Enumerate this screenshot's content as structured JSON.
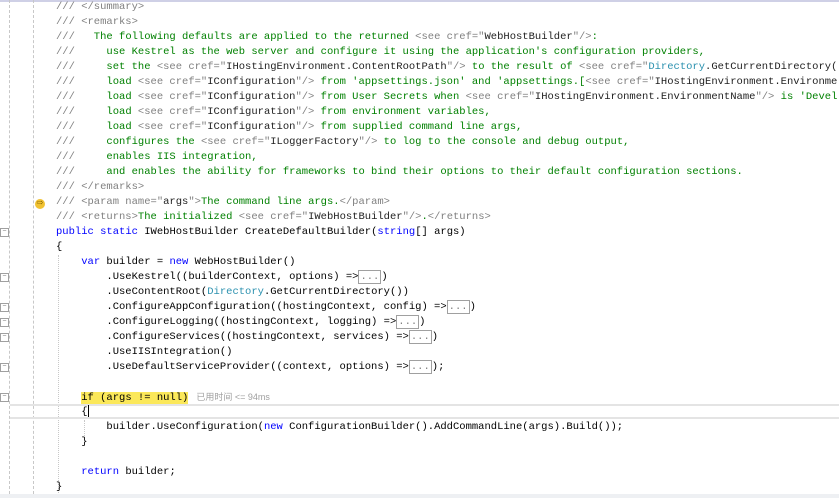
{
  "editor": {
    "perf_hint": "已用时间 <= 94ms",
    "lines": [
      [
        [
          "c",
          "/// </summary>"
        ]
      ],
      [
        [
          "c",
          "/// <remarks>"
        ]
      ],
      [
        [
          "c",
          "///"
        ],
        [
          "g",
          "   The following defaults are applied to the returned "
        ],
        [
          "c",
          "<see cref=\""
        ],
        [
          "d",
          "WebHostBuilder"
        ],
        [
          "c",
          "\"/>"
        ],
        [
          "g",
          ":"
        ]
      ],
      [
        [
          "c",
          "///"
        ],
        [
          "g",
          "     use Kestrel as the web server and configure it using the application's configuration providers,"
        ]
      ],
      [
        [
          "c",
          "///"
        ],
        [
          "g",
          "     set the "
        ],
        [
          "c",
          "<see cref=\""
        ],
        [
          "d",
          "IHostingEnvironment.ContentRootPath"
        ],
        [
          "c",
          "\"/>"
        ],
        [
          "g",
          " to the result of "
        ],
        [
          "c",
          "<see cref=\""
        ],
        [
          "t",
          "Directory"
        ],
        [
          "d",
          ".GetCurrentDirectory()"
        ]
      ],
      [
        [
          "c",
          "///"
        ],
        [
          "g",
          "     load "
        ],
        [
          "c",
          "<see cref=\""
        ],
        [
          "d",
          "IConfiguration"
        ],
        [
          "c",
          "\"/>"
        ],
        [
          "g",
          " from 'appsettings.json' and 'appsettings.["
        ],
        [
          "c",
          "<see cref=\""
        ],
        [
          "d",
          "IHostingEnvironment.Environme"
        ]
      ],
      [
        [
          "c",
          "///"
        ],
        [
          "g",
          "     load "
        ],
        [
          "c",
          "<see cref=\""
        ],
        [
          "d",
          "IConfiguration"
        ],
        [
          "c",
          "\"/>"
        ],
        [
          "g",
          " from User Secrets when "
        ],
        [
          "c",
          "<see cref=\""
        ],
        [
          "d",
          "IHostingEnvironment.EnvironmentName"
        ],
        [
          "c",
          "\"/>"
        ],
        [
          "g",
          " is 'Devel"
        ]
      ],
      [
        [
          "c",
          "///"
        ],
        [
          "g",
          "     load "
        ],
        [
          "c",
          "<see cref=\""
        ],
        [
          "d",
          "IConfiguration"
        ],
        [
          "c",
          "\"/>"
        ],
        [
          "g",
          " from environment variables,"
        ]
      ],
      [
        [
          "c",
          "///"
        ],
        [
          "g",
          "     load "
        ],
        [
          "c",
          "<see cref=\""
        ],
        [
          "d",
          "IConfiguration"
        ],
        [
          "c",
          "\"/>"
        ],
        [
          "g",
          " from supplied command line args,"
        ]
      ],
      [
        [
          "c",
          "///"
        ],
        [
          "g",
          "     configures the "
        ],
        [
          "c",
          "<see cref=\""
        ],
        [
          "d",
          "ILoggerFactory"
        ],
        [
          "c",
          "\"/>"
        ],
        [
          "g",
          " to log to the console and debug output,"
        ]
      ],
      [
        [
          "c",
          "///"
        ],
        [
          "g",
          "     enables IIS integration,"
        ]
      ],
      [
        [
          "c",
          "///"
        ],
        [
          "g",
          "     and enables the ability for frameworks to bind their options to their default configuration sections."
        ]
      ],
      [
        [
          "c",
          "/// </remarks>"
        ]
      ],
      [
        [
          "c",
          "/// <param name=\""
        ],
        [
          "d",
          "args"
        ],
        [
          "c",
          "\">"
        ],
        [
          "g",
          "The command line args."
        ],
        [
          "c",
          "</param>"
        ]
      ],
      [
        [
          "c",
          "/// <returns>"
        ],
        [
          "g",
          "The initialized "
        ],
        [
          "c",
          "<see cref=\""
        ],
        [
          "d",
          "IWebHostBuilder"
        ],
        [
          "c",
          "\"/>"
        ],
        [
          "g",
          "."
        ],
        [
          "c",
          "</returns>"
        ]
      ],
      [
        [
          "k",
          "public"
        ],
        [
          "p",
          " "
        ],
        [
          "k",
          "static"
        ],
        [
          "p",
          " IWebHostBuilder CreateDefaultBuilder("
        ],
        [
          "k",
          "string"
        ],
        [
          "p",
          "[] args)"
        ]
      ],
      [
        [
          "p",
          "{"
        ]
      ],
      [
        [
          "p",
          "    "
        ],
        [
          "k",
          "var"
        ],
        [
          "p",
          " builder = "
        ],
        [
          "k",
          "new"
        ],
        [
          "p",
          " WebHostBuilder()"
        ]
      ],
      [
        [
          "p",
          "        .UseKestrel((builderContext, options) =>"
        ],
        [
          "s",
          "..."
        ],
        [
          "p",
          ")"
        ]
      ],
      [
        [
          "p",
          "        .UseContentRoot("
        ],
        [
          "t",
          "Directory"
        ],
        [
          "p",
          ".GetCurrentDirectory())"
        ]
      ],
      [
        [
          "p",
          "        .ConfigureAppConfiguration((hostingContext, config) =>"
        ],
        [
          "s",
          "..."
        ],
        [
          "p",
          ")"
        ]
      ],
      [
        [
          "p",
          "        .ConfigureLogging((hostingContext, logging) =>"
        ],
        [
          "s",
          "..."
        ],
        [
          "p",
          ")"
        ]
      ],
      [
        [
          "p",
          "        .ConfigureServices((hostingContext, services) =>"
        ],
        [
          "s",
          "..."
        ],
        [
          "p",
          ")"
        ]
      ],
      [
        [
          "p",
          "        .UseIISIntegration()"
        ]
      ],
      [
        [
          "p",
          "        .UseDefaultServiceProvider((context, options) =>"
        ],
        [
          "s",
          "..."
        ],
        [
          "p",
          ");"
        ]
      ],
      [],
      [
        [
          "p",
          "    "
        ],
        [
          "h",
          "if (args != null)"
        ]
      ],
      [
        [
          "p",
          "    {"
        ]
      ],
      [
        [
          "p",
          "        builder.UseConfiguration("
        ],
        [
          "k",
          "new"
        ],
        [
          "p",
          " ConfigurationBuilder().AddCommandLine(args).Build());"
        ]
      ],
      [
        [
          "p",
          "    }"
        ]
      ],
      [],
      [
        [
          "p",
          "    "
        ],
        [
          "k",
          "return"
        ],
        [
          "p",
          " builder;"
        ]
      ],
      [
        [
          "p",
          "}"
        ]
      ]
    ]
  }
}
